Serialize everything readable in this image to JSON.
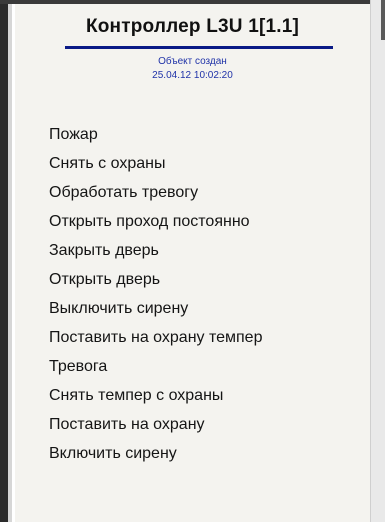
{
  "header": {
    "title": "Контроллер L3U 1[1.1]",
    "subtitle_line1": "Объект создан",
    "subtitle_line2": "25.04.12 10:02:20"
  },
  "menu": {
    "items": [
      {
        "label": "Пожар"
      },
      {
        "label": "Снять с охраны"
      },
      {
        "label": "Обработать тревогу"
      },
      {
        "label": "Открыть проход постоянно"
      },
      {
        "label": "Закрыть дверь"
      },
      {
        "label": "Открыть дверь"
      },
      {
        "label": "Выключить сирену"
      },
      {
        "label": "Поставить на охрану темпер"
      },
      {
        "label": "Тревога"
      },
      {
        "label": "Снять темпер с охраны"
      },
      {
        "label": "Поставить на охрану"
      },
      {
        "label": "Включить сирену"
      }
    ]
  },
  "colors": {
    "title_rule": "#0a1a86",
    "subtitle_text": "#2033a8",
    "menu_background": "#f4f3ef"
  }
}
